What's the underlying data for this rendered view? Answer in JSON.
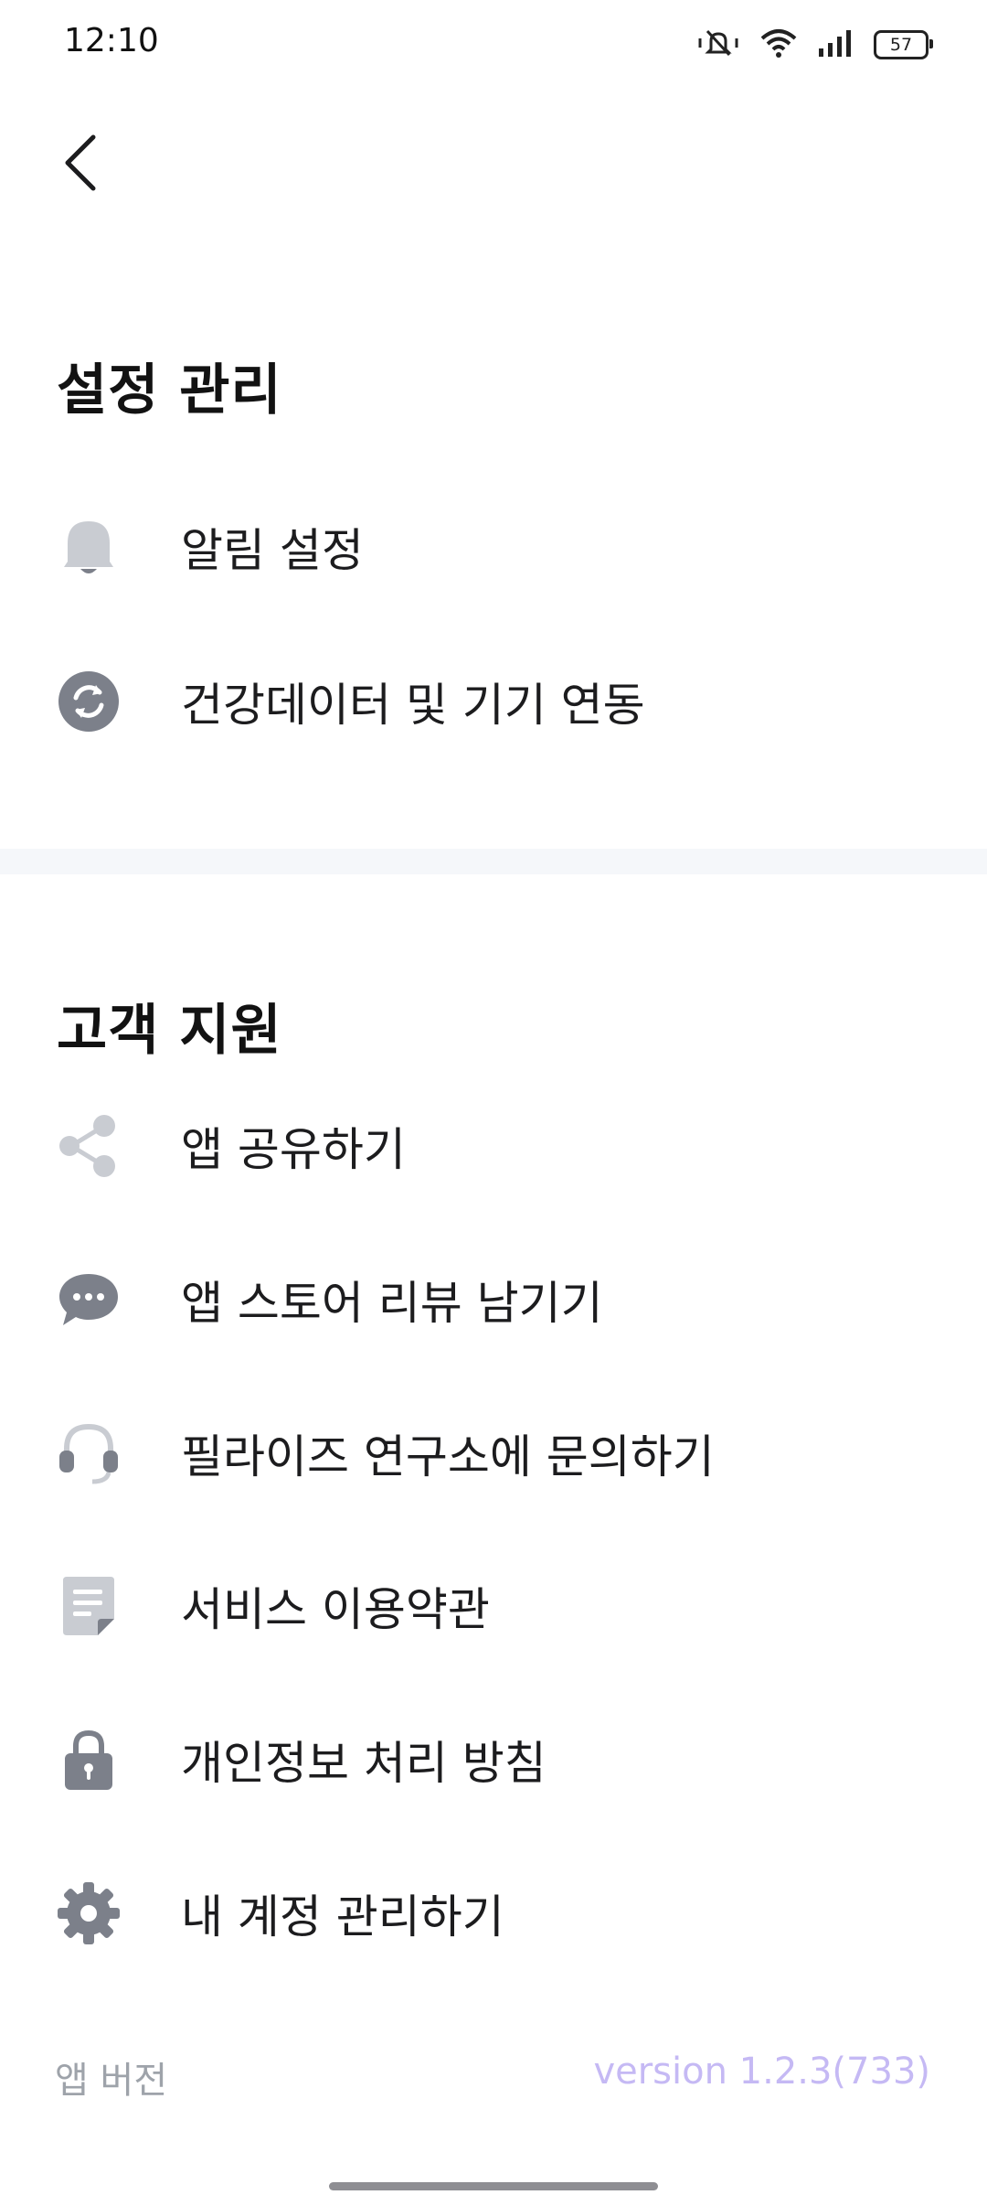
{
  "status_bar": {
    "time": "12:10",
    "battery": "57",
    "icons": [
      "mute-icon",
      "wifi-icon",
      "signal-icon",
      "battery-icon"
    ]
  },
  "navigation": {
    "back_icon": "chevron-left-icon"
  },
  "settings": {
    "title": "설정 관리",
    "items": [
      {
        "label": "알림 설정",
        "icon": "bell-icon"
      },
      {
        "label": "건강데이터 및 기기 연동",
        "icon": "sync-icon"
      }
    ]
  },
  "support": {
    "title": "고객 지원",
    "items": [
      {
        "label": "앱 공유하기",
        "icon": "share-icon"
      },
      {
        "label": "앱 스토어 리뷰 남기기",
        "icon": "chat-bubble-icon"
      },
      {
        "label": "필라이즈 연구소에 문의하기",
        "icon": "headset-icon"
      },
      {
        "label": "서비스 이용약관",
        "icon": "document-icon"
      },
      {
        "label": "개인정보 처리 방침",
        "icon": "lock-icon"
      },
      {
        "label": "내 계정 관리하기",
        "icon": "gear-icon"
      }
    ]
  },
  "footer": {
    "version_label": "앱 버전",
    "version_value": "version 1.2.3(733)"
  },
  "colors": {
    "icon_gray": "#c9ccd2",
    "icon_dark": "#7c808a",
    "accent_version": "#c5b9f4",
    "divider": "#f5f7fa"
  }
}
